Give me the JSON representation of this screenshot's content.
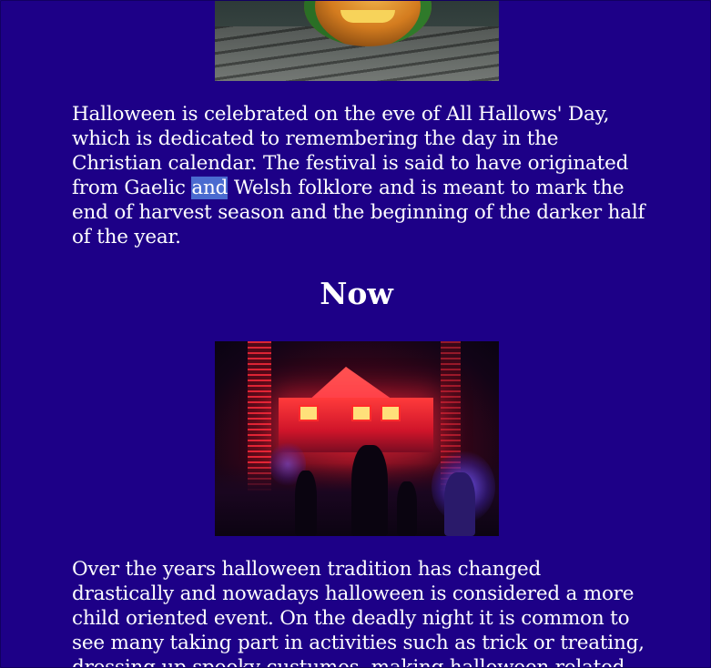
{
  "article": {
    "paragraph1": {
      "before": "Halloween is celebrated on the eve of All Hallows' Day, which is dedicated to remembering the day in the Christian calendar. The festival is said to have originated from Gaelic ",
      "selected": "and",
      "after": " Welsh folklore and is meant to mark the end of harvest season and the beginning of the darker half of the year."
    },
    "section_heading": "Now",
    "paragraph2": "Over the years halloween tradition has changed drastically and nowadays halloween is considered a more child oriented event. On the deadly night it is common to see many taking part in activities such as trick or treating, dressing up spooky custumes, making halloween related"
  },
  "images": {
    "top": "jack-o-lantern pumpkin on wooden planks",
    "now": "house decorated with red halloween lights and people in costumes"
  },
  "colors": {
    "background": "#1d0087",
    "text": "#ffffff",
    "selection": "#4a6bd0"
  }
}
